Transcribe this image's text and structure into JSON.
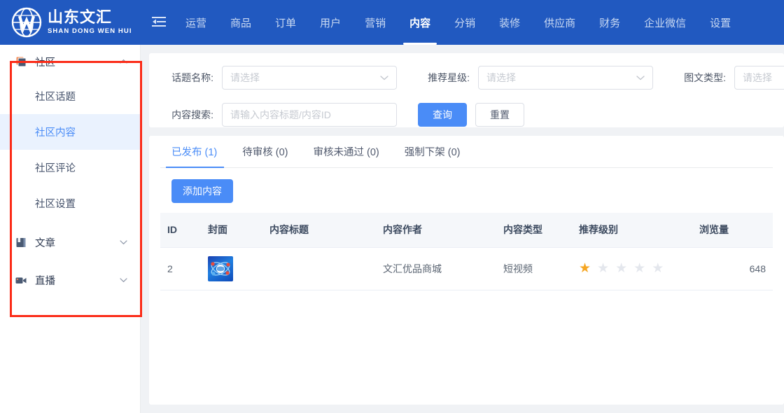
{
  "header": {
    "brand_cn": "山东文汇",
    "brand_en": "SHAN DONG WEN HUI",
    "collapse_icon": "menu-fold-icon",
    "nav": [
      {
        "label": "运营",
        "active": false
      },
      {
        "label": "商品",
        "active": false
      },
      {
        "label": "订单",
        "active": false
      },
      {
        "label": "用户",
        "active": false
      },
      {
        "label": "营销",
        "active": false
      },
      {
        "label": "内容",
        "active": true
      },
      {
        "label": "分销",
        "active": false
      },
      {
        "label": "装修",
        "active": false
      },
      {
        "label": "供应商",
        "active": false
      },
      {
        "label": "财务",
        "active": false
      },
      {
        "label": "企业微信",
        "active": false
      },
      {
        "label": "设置",
        "active": false
      }
    ],
    "accent_bg": "#2159c0",
    "active_color": "#ffffff",
    "inactive_color": "#c9d9f2"
  },
  "sidebar": {
    "groups": [
      {
        "label": "社区",
        "icon": "layers-icon",
        "expanded": true,
        "chevron": "chevron-up-icon",
        "items": [
          {
            "label": "社区话题",
            "active": false
          },
          {
            "label": "社区内容",
            "active": true
          },
          {
            "label": "社区评论",
            "active": false
          },
          {
            "label": "社区设置",
            "active": false
          }
        ]
      },
      {
        "label": "文章",
        "icon": "book-icon",
        "expanded": false,
        "chevron": "chevron-down-icon",
        "items": []
      },
      {
        "label": "直播",
        "icon": "video-camera-icon",
        "expanded": false,
        "chevron": "chevron-down-icon",
        "items": []
      }
    ],
    "active_color": "#4a8cf7",
    "active_bg": "#eaf2fe"
  },
  "annotation": {
    "box_color": "#fb2b17",
    "target": "sidebar-menu"
  },
  "filters": {
    "topic_name": {
      "label": "话题名称:",
      "placeholder": "请选择",
      "value": "",
      "icon": "chevron-down-icon"
    },
    "recommend_star": {
      "label": "推荐星级:",
      "placeholder": "请选择",
      "value": "",
      "icon": "chevron-down-icon"
    },
    "media_type": {
      "label": "图文类型:",
      "placeholder": "请选择",
      "value": "",
      "icon": "chevron-down-icon"
    },
    "content_search": {
      "label": "内容搜索:",
      "placeholder": "请输入内容标题/内容ID",
      "value": ""
    },
    "query_button": "查询",
    "reset_button": "重置"
  },
  "tabs": [
    {
      "label": "已发布 (1)",
      "active": true
    },
    {
      "label": "待审核 (0)",
      "active": false
    },
    {
      "label": "审核未通过 (0)",
      "active": false
    },
    {
      "label": "强制下架 (0)",
      "active": false
    }
  ],
  "toolbar": {
    "add_content_label": "添加内容"
  },
  "table": {
    "columns": [
      "ID",
      "封面",
      "内容标题",
      "内容作者",
      "内容类型",
      "推荐级别",
      "浏览量"
    ],
    "rows": [
      {
        "id": "2",
        "cover": "globe-network-thumbnail",
        "title": "",
        "author": "文汇优品商城",
        "type": "短视频",
        "rating": 1,
        "rating_max": 5,
        "views": "648"
      }
    ],
    "star_filled_color": "#f6a623",
    "star_empty_color": "#e4e7ed"
  }
}
